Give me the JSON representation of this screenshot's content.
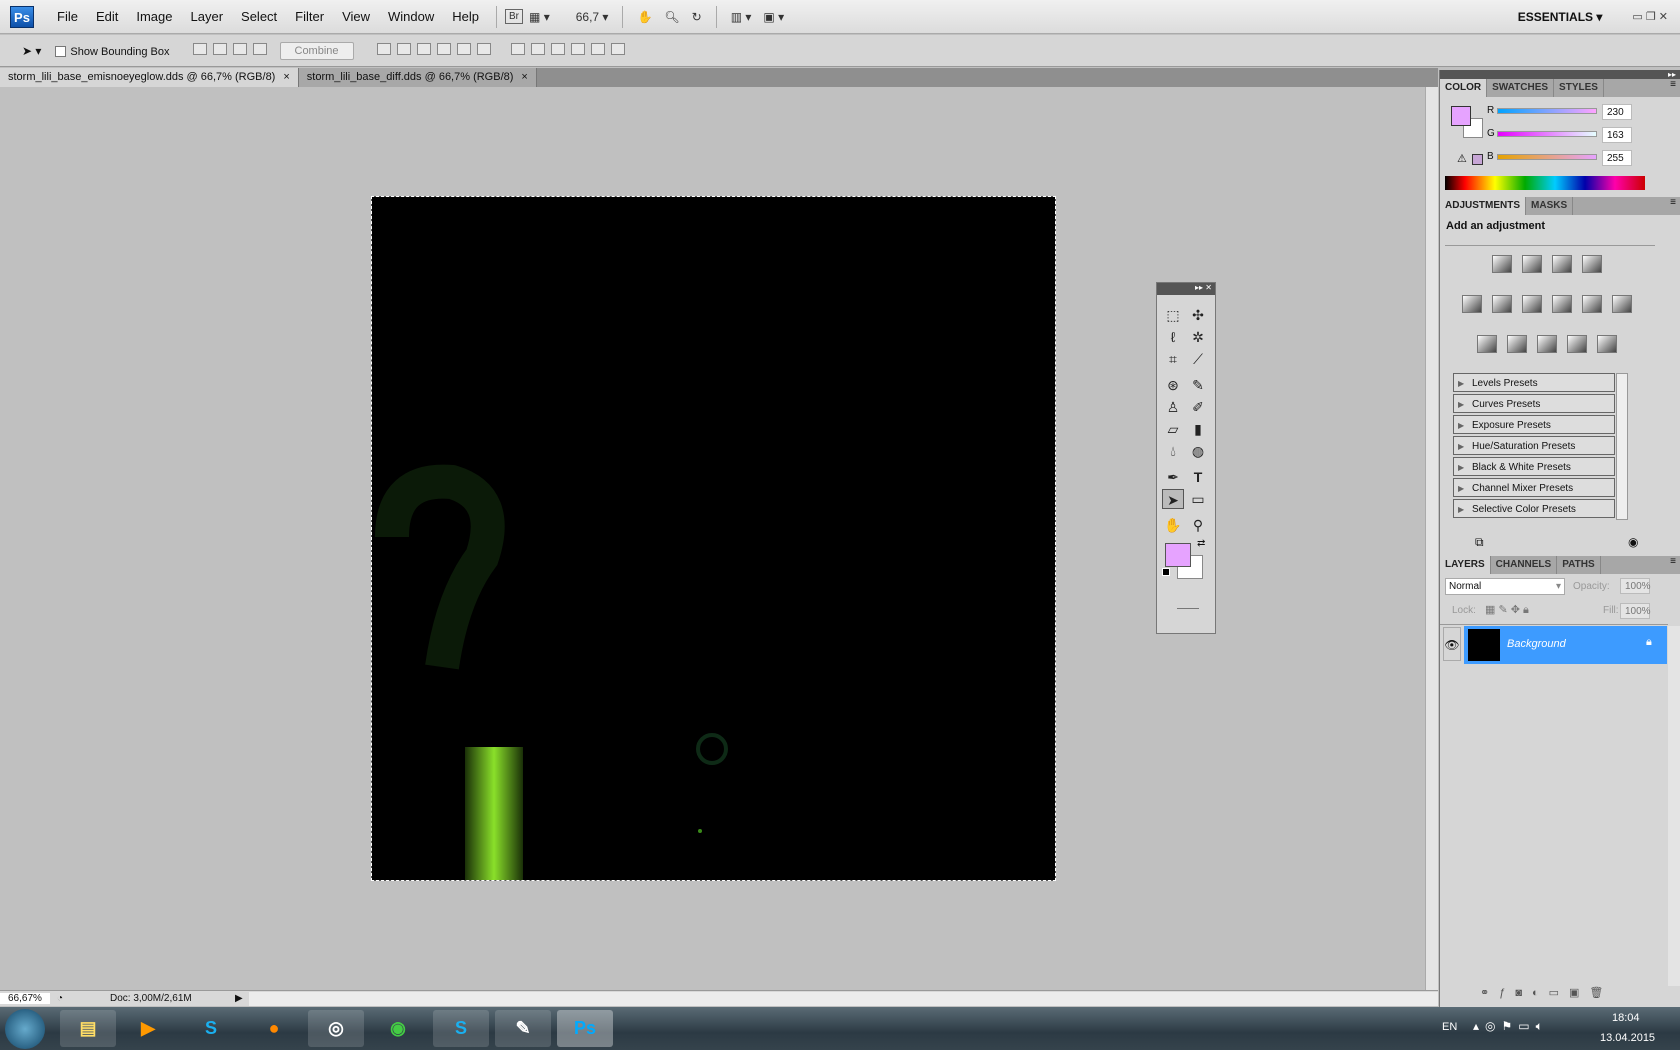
{
  "app": {
    "logo": "Ps"
  },
  "menu": [
    "File",
    "Edit",
    "Image",
    "Layer",
    "Select",
    "Filter",
    "View",
    "Window",
    "Help"
  ],
  "appbar": {
    "bridge": "Br",
    "zoom": "66,7",
    "workspace": "ESSENTIALS"
  },
  "options": {
    "show_bounding_box": "Show Bounding Box",
    "combine": "Combine"
  },
  "tabs": [
    {
      "label": "storm_lili_base_emisnoeyeglow.dds @ 66,7% (RGB/8)",
      "active": true
    },
    {
      "label": "storm_lili_base_diff.dds @ 66,7% (RGB/8)",
      "active": false
    }
  ],
  "status": {
    "zoom": "66,67%",
    "doc": "Doc: 3,00M/2,61M"
  },
  "color_panel": {
    "tabs": [
      "COLOR",
      "SWATCHES",
      "STYLES"
    ],
    "r_label": "R",
    "g_label": "G",
    "b_label": "B",
    "r": "230",
    "g": "163",
    "b": "255",
    "foreground": "#e6a3ff",
    "background": "#ffffff"
  },
  "adjustments": {
    "tabs": [
      "ADJUSTMENTS",
      "MASKS"
    ],
    "title": "Add an adjustment",
    "presets": [
      "Levels Presets",
      "Curves Presets",
      "Exposure Presets",
      "Hue/Saturation Presets",
      "Black & White Presets",
      "Channel Mixer Presets",
      "Selective Color Presets"
    ]
  },
  "layers": {
    "tabs": [
      "LAYERS",
      "CHANNELS",
      "PATHS"
    ],
    "blend_mode": "Normal",
    "opacity_label": "Opacity:",
    "opacity": "100%",
    "lock_label": "Lock:",
    "fill_label": "Fill:",
    "fill": "100%",
    "items": [
      {
        "name": "Background",
        "selected": true
      }
    ]
  },
  "taskbar": {
    "lang": "EN",
    "time": "18:04",
    "date": "13.04.2015",
    "apps": [
      "Windows Explorer",
      "Media Player",
      "Skype",
      "Origin",
      "Steam",
      "Chrome",
      "Skype",
      "Paint",
      "Photoshop"
    ]
  }
}
